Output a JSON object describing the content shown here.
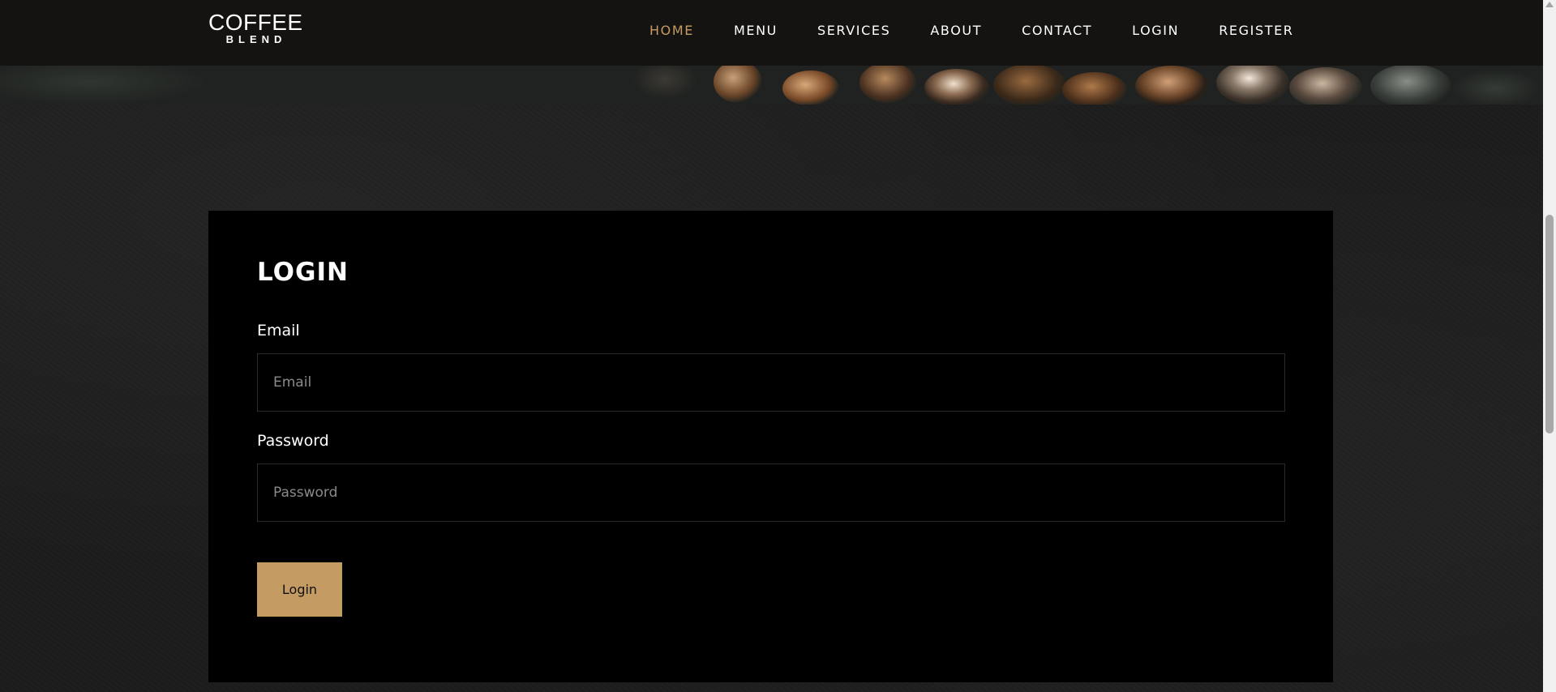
{
  "brand": {
    "top": "COFFEE",
    "bottom": "BLEND"
  },
  "nav": {
    "items": [
      {
        "label": "HOME",
        "active": true
      },
      {
        "label": "MENU",
        "active": false
      },
      {
        "label": "SERVICES",
        "active": false
      },
      {
        "label": "ABOUT",
        "active": false
      },
      {
        "label": "CONTACT",
        "active": false
      },
      {
        "label": "LOGIN",
        "active": false
      },
      {
        "label": "REGISTER",
        "active": false
      }
    ]
  },
  "login": {
    "title": "LOGIN",
    "email_label": "Email",
    "email_placeholder": "Email",
    "email_value": "",
    "password_label": "Password",
    "password_placeholder": "Password",
    "password_value": "",
    "submit_label": "Login"
  },
  "colors": {
    "accent": "#c49b63",
    "header_bg": "#141312",
    "card_bg": "#000000",
    "page_bg": "#1c1c1c"
  }
}
